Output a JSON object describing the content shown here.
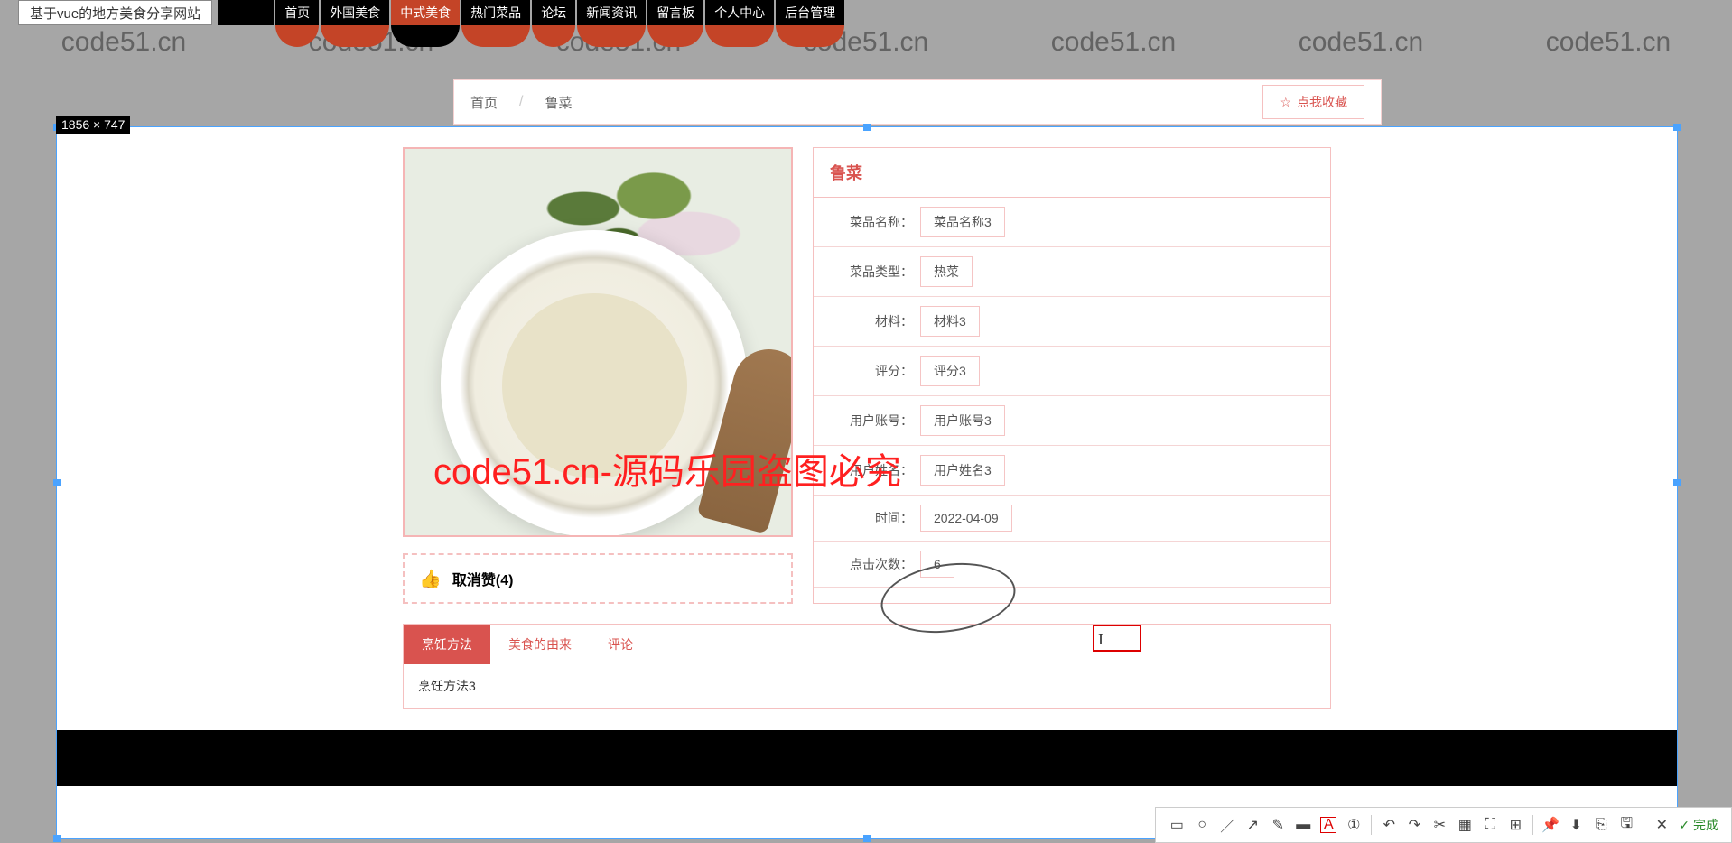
{
  "site_title": "基于vue的地方美食分享网站",
  "nav": {
    "items": [
      {
        "label": "首页",
        "active": false
      },
      {
        "label": "外国美食",
        "active": false
      },
      {
        "label": "中式美食",
        "active": true
      },
      {
        "label": "热门菜品",
        "active": false
      },
      {
        "label": "论坛",
        "active": false
      },
      {
        "label": "新闻资讯",
        "active": false
      },
      {
        "label": "留言板",
        "active": false
      },
      {
        "label": "个人中心",
        "active": false
      },
      {
        "label": "后台管理",
        "active": false
      }
    ]
  },
  "dimensions_label": "1856 × 747",
  "breadcrumb": {
    "home": "首页",
    "sep": "/",
    "current": "鲁菜"
  },
  "favorite_label": "点我收藏",
  "like": {
    "label": "取消赞",
    "count": "(4)"
  },
  "detail": {
    "title": "鲁菜",
    "rows": [
      {
        "label": "菜品名称：",
        "value": "菜品名称3"
      },
      {
        "label": "菜品类型：",
        "value": "热菜"
      },
      {
        "label": "材料：",
        "value": "材料3"
      },
      {
        "label": "评分：",
        "value": "评分3"
      },
      {
        "label": "用户账号：",
        "value": "用户账号3"
      },
      {
        "label": "用户姓名：",
        "value": "用户姓名3"
      },
      {
        "label": "时间：",
        "value": "2022-04-09"
      },
      {
        "label": "点击次数：",
        "value": "6"
      }
    ]
  },
  "tabs": {
    "items": [
      {
        "label": "烹饪方法",
        "active": true
      },
      {
        "label": "美食的由来",
        "active": false
      },
      {
        "label": "评论",
        "active": false
      }
    ],
    "content": "烹饪方法3"
  },
  "watermark_text": "code51.cn",
  "center_watermark": "code51.cn-源码乐园盗图必究",
  "toolbar": {
    "done": "完成",
    "icons": [
      "rect-icon",
      "circle-icon",
      "line-icon",
      "arrow-icon",
      "pen-icon",
      "marker-icon",
      "text-icon",
      "counter-icon",
      "undo-icon",
      "redo-icon",
      "crop-icon",
      "blur-icon",
      "reselect-icon",
      "pin-icon",
      "download-icon",
      "copy-icon",
      "save-icon",
      "close-icon"
    ]
  }
}
